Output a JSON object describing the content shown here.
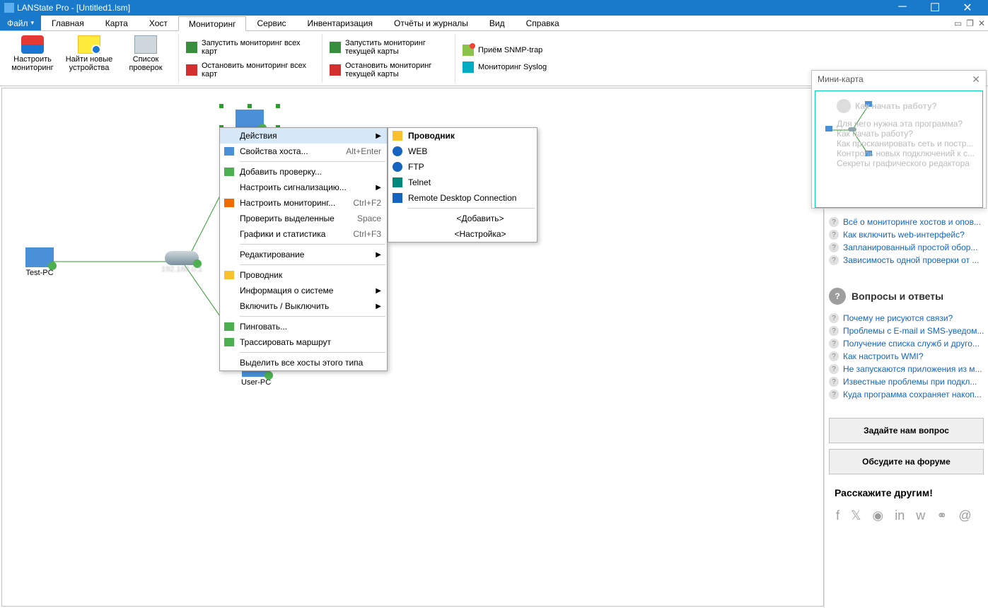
{
  "title": "LANState Pro - [Untitled1.lsm]",
  "menu": {
    "file": "Файл",
    "tabs": [
      "Главная",
      "Карта",
      "Хост",
      "Мониторинг",
      "Сервис",
      "Инвентаризация",
      "Отчёты и журналы",
      "Вид",
      "Справка"
    ],
    "active_index": 3
  },
  "ribbon": {
    "big": [
      {
        "label": "Настроить мониторинг"
      },
      {
        "label": "Найти новые устройства"
      },
      {
        "label": "Список проверок"
      }
    ],
    "col1": [
      "Запустить мониторинг всех карт",
      "Остановить мониторинг всех карт"
    ],
    "col2": [
      "Запустить мониторинг текущей карты",
      "Остановить мониторинг текущей карты"
    ],
    "col3": [
      "Приём SNMP-trap",
      "Мониторинг Syslog"
    ]
  },
  "hosts": {
    "left": "Test-PC",
    "bottom": "User-PC"
  },
  "context_menu": {
    "items": [
      {
        "label": "Действия",
        "sub": true,
        "highlight": true
      },
      {
        "label": "Свойства хоста...",
        "shortcut": "Alt+Enter"
      },
      {
        "label": "Добавить проверку..."
      },
      {
        "label": "Настроить сигнализацию...",
        "sub": true
      },
      {
        "label": "Настроить мониторинг...",
        "shortcut": "Ctrl+F2"
      },
      {
        "label": "Проверить выделенные",
        "shortcut": "Space"
      },
      {
        "label": "Графики и статистика",
        "shortcut": "Ctrl+F3"
      },
      {
        "label": "Редактирование",
        "sub": true
      },
      {
        "label": "Проводник"
      },
      {
        "label": "Информация о системе",
        "sub": true
      },
      {
        "label": "Включить / Выключить",
        "sub": true
      },
      {
        "label": "Пинговать..."
      },
      {
        "label": "Трассировать маршрут"
      },
      {
        "label": "Выделить все хосты этого типа"
      }
    ],
    "separators_after": [
      1,
      6,
      7,
      10,
      12
    ]
  },
  "submenu": {
    "items": [
      {
        "label": "Проводник",
        "bold": true
      },
      {
        "label": "WEB"
      },
      {
        "label": "FTP"
      },
      {
        "label": "Telnet"
      },
      {
        "label": "Remote Desktop Connection"
      },
      {
        "label": "<Добавить>",
        "center": true
      },
      {
        "label": "<Настройка>",
        "center": true
      }
    ],
    "separator_after": 4
  },
  "minimap": {
    "title": "Мини-карта"
  },
  "side": {
    "start_title": "Как начать работу?",
    "start_items": [
      "Для чего нужна эта программа?",
      "Как начать работу?",
      "Как просканировать сеть и постр...",
      "Контроль новых подключений к с...",
      "Секреты графического редактора",
      "Всё о мониторинге хостов и опов...",
      "Как включить web-интерфейс?",
      "Запланированный простой обор...",
      "Зависимость одной проверки от ..."
    ],
    "faq_title": "Вопросы и ответы",
    "faq_items": [
      "Почему не рисуются связи?",
      "Проблемы с E-mail и SMS-уведом...",
      "Получение списка служб и друго...",
      "Как настроить WMI?",
      "Не запускаются приложения из м...",
      "Известные проблемы при подкл...",
      "Куда программа сохраняет накоп..."
    ],
    "btn_ask": "Задайте нам вопрос",
    "btn_forum": "Обсудите на форуме",
    "share_title": "Расскажите другим!"
  }
}
